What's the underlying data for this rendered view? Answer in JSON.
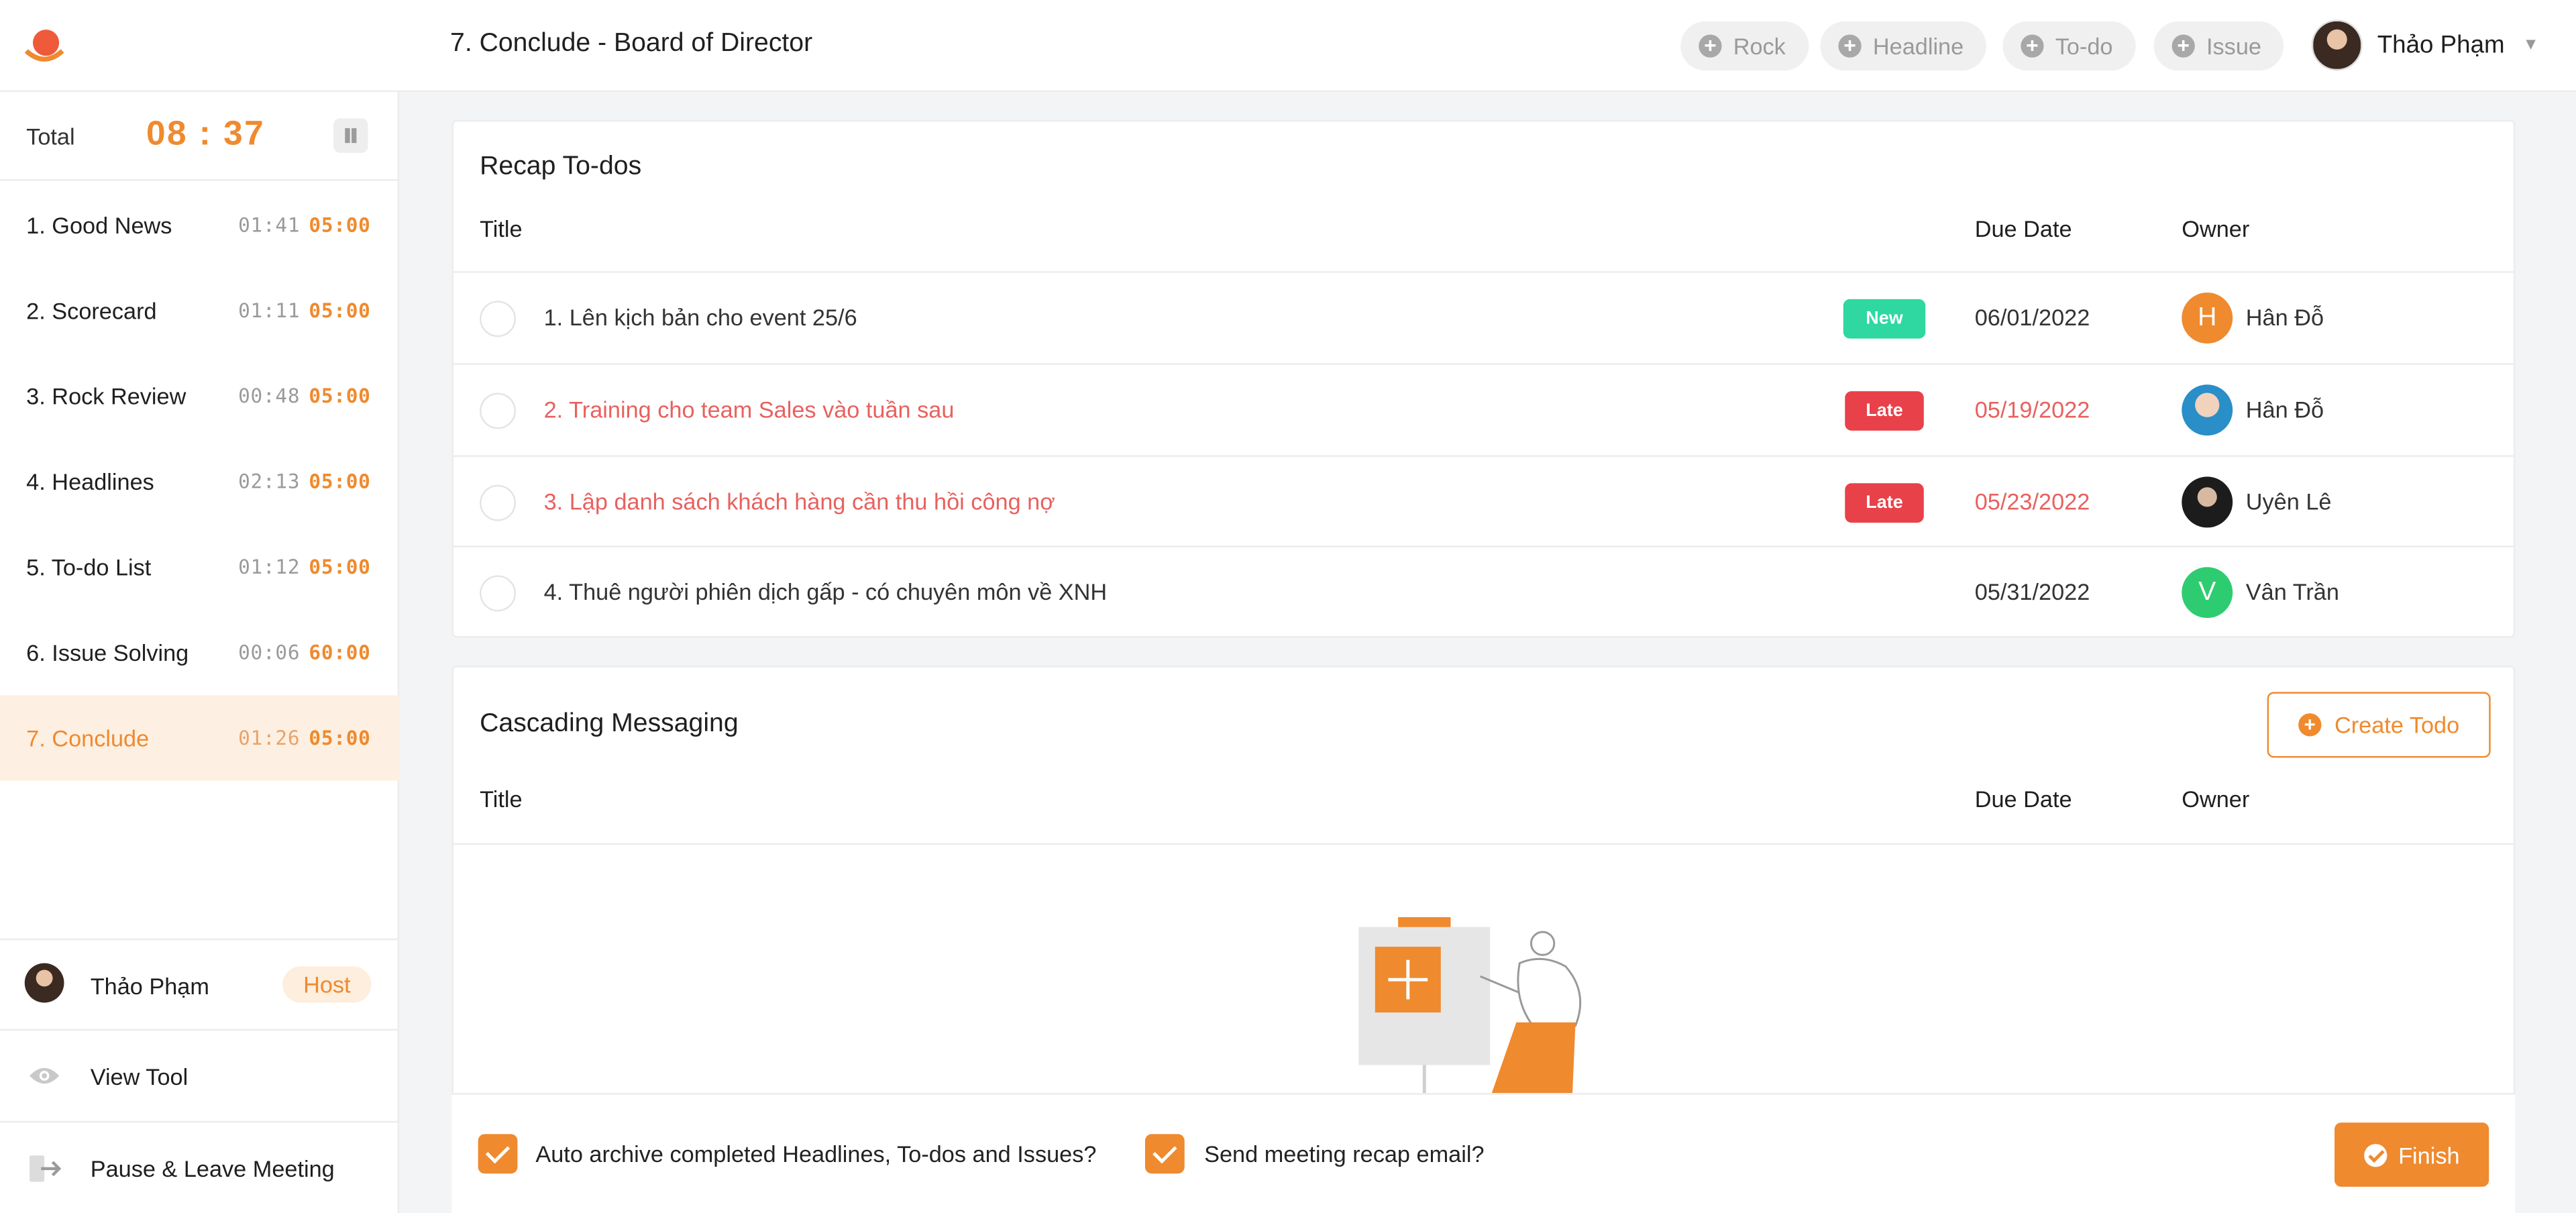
{
  "header": {
    "meeting_title": "7. Conclude - Board of Director",
    "quick_actions": [
      {
        "label": "Rock"
      },
      {
        "label": "Headline"
      },
      {
        "label": "To-do"
      },
      {
        "label": "Issue"
      }
    ],
    "user_name": "Thảo Phạm"
  },
  "sidebar": {
    "total_label": "Total",
    "total_time": "08 : 37",
    "agenda": [
      {
        "label": "1.  Good News",
        "elapsed": "01:41",
        "limit": "05:00"
      },
      {
        "label": "2.  Scorecard",
        "elapsed": "01:11",
        "limit": "05:00"
      },
      {
        "label": "3.  Rock Review",
        "elapsed": "00:48",
        "limit": "05:00"
      },
      {
        "label": "4.  Headlines",
        "elapsed": "02:13",
        "limit": "05:00"
      },
      {
        "label": "5.  To-do List",
        "elapsed": "01:12",
        "limit": "05:00"
      },
      {
        "label": "6.  Issue Solving",
        "elapsed": "00:06",
        "limit": "60:00"
      },
      {
        "label": "7.  Conclude",
        "elapsed": "01:26",
        "limit": "05:00"
      }
    ],
    "active_index": 6,
    "host_name": "Thảo Phạm",
    "host_badge": "Host",
    "view_tool": "View Tool",
    "leave": "Pause & Leave Meeting"
  },
  "recap": {
    "title": "Recap To-dos",
    "col_title": "Title",
    "col_due": "Due Date",
    "col_owner": "Owner",
    "rows": [
      {
        "title": "1. Lên kịch bản cho event 25/6",
        "badge": "New",
        "due": "06/01/2022",
        "owner": "Hân Đỗ",
        "owner_initial": "H",
        "status": "new"
      },
      {
        "title": "2. Training cho team Sales vào tuần sau",
        "badge": "Late",
        "due": "05/19/2022",
        "owner": "Hân Đỗ",
        "owner_initial": "",
        "status": "late"
      },
      {
        "title": "3. Lập danh sách khách hàng cần thu hồi công nợ",
        "badge": "Late",
        "due": "05/23/2022",
        "owner": "Uyên Lê",
        "owner_initial": "",
        "status": "late"
      },
      {
        "title": "4. Thuê người phiên dịch gấp - có chuyên môn về XNH",
        "badge": "",
        "due": "05/31/2022",
        "owner": "Vân Trần",
        "owner_initial": "V",
        "status": "normal"
      }
    ]
  },
  "cascading": {
    "title": "Cascading Messaging",
    "create_label": "Create Todo",
    "col_title": "Title",
    "col_due": "Due Date",
    "col_owner": "Owner"
  },
  "footer": {
    "auto_archive": "Auto archive completed Headlines, To-dos and Issues?",
    "send_recap": "Send meeting recap email?",
    "finish": "Finish"
  },
  "colors": {
    "accent": "#ef8a2e",
    "new_badge": "#2ed8a0",
    "late_badge": "#e8414a",
    "late_text": "#e8615f"
  }
}
